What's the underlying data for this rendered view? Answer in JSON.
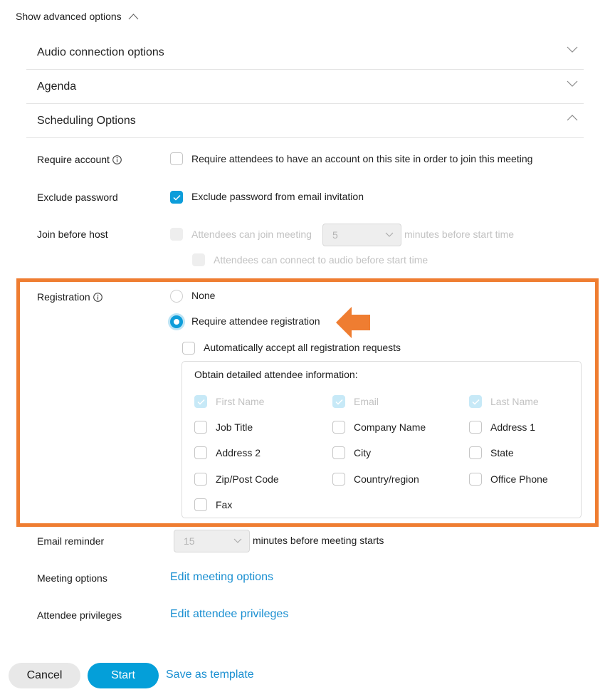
{
  "advanced_toggle": {
    "label": "Show advanced options",
    "icon": "chevron-up-icon",
    "expanded": true
  },
  "accordions": [
    {
      "title": "Audio connection options",
      "icon": "chevron-down-icon",
      "expanded": false
    },
    {
      "title": "Agenda",
      "icon": "chevron-down-icon",
      "expanded": false
    },
    {
      "title": "Scheduling Options",
      "icon": "chevron-up-icon",
      "expanded": true
    }
  ],
  "scheduling": {
    "require_account": {
      "label": "Require account",
      "info_icon": "info-icon",
      "option": "Require attendees to have an account on this site in order to join this meeting",
      "checked": false
    },
    "exclude_password": {
      "label": "Exclude password",
      "option": "Exclude password from email invitation",
      "checked": true
    },
    "join_before_host": {
      "label": "Join before host",
      "option_prefix": "Attendees can join meeting",
      "minutes_value": "5",
      "option_suffix": "minutes before start time",
      "audio_option": "Attendees can connect to audio before start time",
      "disabled": true
    },
    "registration": {
      "label": "Registration",
      "info_icon": "info-icon",
      "options": [
        {
          "label": "None",
          "selected": false
        },
        {
          "label": "Require attendee registration",
          "selected": true
        }
      ],
      "auto_accept": {
        "label": "Automatically accept all registration requests",
        "checked": false
      },
      "detail_heading": "Obtain detailed attendee information:",
      "fields": [
        {
          "label": "First Name",
          "checked": true,
          "disabled": true
        },
        {
          "label": "Email",
          "checked": true,
          "disabled": true
        },
        {
          "label": "Last Name",
          "checked": true,
          "disabled": true
        },
        {
          "label": "Job Title",
          "checked": false,
          "disabled": false
        },
        {
          "label": "Company Name",
          "checked": false,
          "disabled": false
        },
        {
          "label": "Address 1",
          "checked": false,
          "disabled": false
        },
        {
          "label": "Address 2",
          "checked": false,
          "disabled": false
        },
        {
          "label": "City",
          "checked": false,
          "disabled": false
        },
        {
          "label": "State",
          "checked": false,
          "disabled": false
        },
        {
          "label": "Zip/Post Code",
          "checked": false,
          "disabled": false
        },
        {
          "label": "Country/region",
          "checked": false,
          "disabled": false
        },
        {
          "label": "Office Phone",
          "checked": false,
          "disabled": false
        },
        {
          "label": "Fax",
          "checked": false,
          "disabled": false
        }
      ]
    },
    "email_reminder": {
      "label": "Email reminder",
      "value": "15",
      "suffix": "minutes before meeting starts"
    },
    "meeting_options": {
      "label": "Meeting options",
      "link": "Edit meeting options"
    },
    "attendee_privileges": {
      "label": "Attendee privileges",
      "link": "Edit attendee privileges"
    }
  },
  "annotation": {
    "highlight_color": "#ef7d31",
    "arrow_icon": "arrow-left-icon"
  },
  "actions": {
    "cancel": "Cancel",
    "start": "Start",
    "save_template": "Save as template"
  },
  "colors": {
    "accent": "#049fd9",
    "link": "#1a8fd1",
    "highlight": "#ef7d31"
  }
}
